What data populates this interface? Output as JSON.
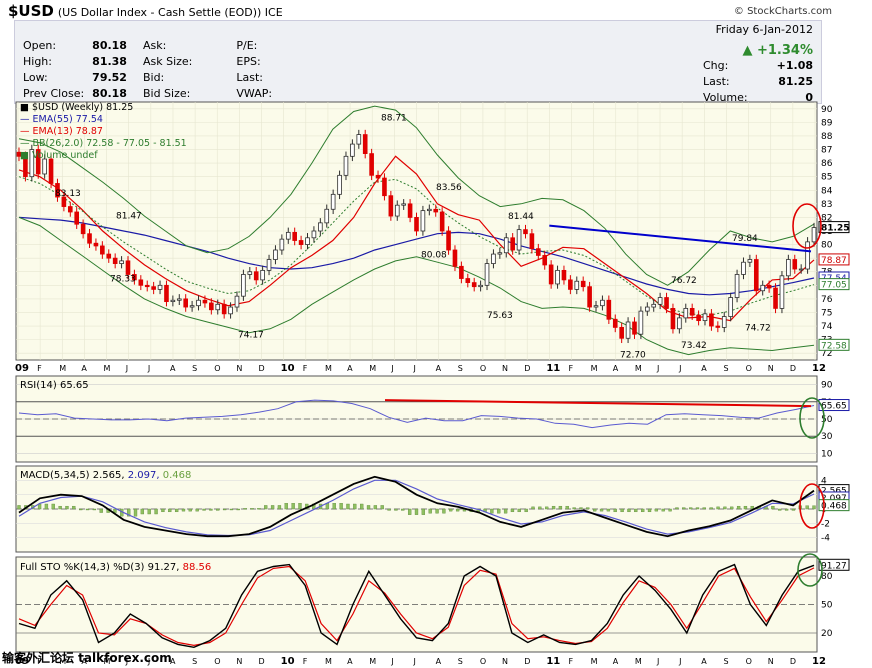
{
  "header": {
    "symbol": "$USD",
    "description": "(US Dollar Index - Cash Settle (EOD)) ICE",
    "brand": "© StockCharts.com"
  },
  "quote": {
    "date": "Friday  6-Jan-2012",
    "change_pct": "▲ +1.34%",
    "rows": [
      {
        "l1": "Open:",
        "v1": "80.18",
        "l2": "Ask:",
        "l3": "P/E:"
      },
      {
        "l1": "High:",
        "v1": "81.38",
        "l2": "Ask Size:",
        "l3": "EPS:"
      },
      {
        "l1": "Low:",
        "v1": "79.52",
        "l2": "Bid:",
        "l3": "Last:"
      },
      {
        "l1": "Prev Close:",
        "v1": "80.18",
        "l2": "Bid Size:",
        "l3": "VWAP:"
      }
    ],
    "chg_label": "Chg:",
    "chg": "+1.08",
    "last_label": "Last:",
    "last": "81.25",
    "volume_label": "Volume:",
    "volume": "0"
  },
  "legend": {
    "main": "■ $USD (Weekly) 81.25",
    "ema55": "— EMA(55) 77.54",
    "ema13": "— EMA(13) 78.87",
    "bb": "— BB(26,2.0) 72.58 - 77.05 - 81.51",
    "vol": "■ Volume undef",
    "rsi": "RSI(14) 65.65",
    "macd_a": "MACD(5,34,5) 2.565,",
    "macd_b": "2.097,",
    "macd_c": "0.468",
    "sto_a": "Full STO %K(14,3) %D(3) 91.27,",
    "sto_b": "88.56"
  },
  "watermark": "输客外汇论坛 talkforex.com",
  "colors": {
    "up": "#2e2e2e",
    "down": "#e00000",
    "ema55": "#1a1aa6",
    "ema13": "#e00000",
    "bb": "#2e7d2e",
    "trend": "#0000cc",
    "bg": "#fbfbea"
  },
  "chart_data": [
    {
      "type": "candlestick",
      "title": "$USD (Weekly) 81.25",
      "x_labels": [
        "09",
        "F",
        "M",
        "A",
        "M",
        "J",
        "J",
        "A",
        "S",
        "O",
        "N",
        "D",
        "10",
        "F",
        "M",
        "A",
        "M",
        "J",
        "J",
        "A",
        "S",
        "O",
        "N",
        "D",
        "11",
        "F",
        "M",
        "A",
        "M",
        "J",
        "J",
        "A",
        "S",
        "O",
        "N",
        "D",
        "12"
      ],
      "ylim": [
        71.5,
        90.5
      ],
      "y_ticks": [
        72,
        73,
        74,
        75,
        76,
        77,
        78,
        79,
        80,
        81,
        82,
        83,
        84,
        85,
        86,
        87,
        88,
        89,
        90
      ],
      "right_labels": [
        "81.25",
        "78.87",
        "77.54",
        "77.05",
        "72.58"
      ],
      "annotations": [
        {
          "x": "2009-02",
          "value": "83.13"
        },
        {
          "x": "2009-05",
          "value": "81.47"
        },
        {
          "x": "2009-06",
          "value": "78.33"
        },
        {
          "x": "2009-11",
          "value": "74.17"
        },
        {
          "x": "2010-06",
          "value": "88.71"
        },
        {
          "x": "2010-08",
          "value": "80.08"
        },
        {
          "x": "2010-09",
          "value": "83.56"
        },
        {
          "x": "2010-11",
          "value": "75.63"
        },
        {
          "x": "2011-01",
          "value": "81.44"
        },
        {
          "x": "2011-05",
          "value": "72.70"
        },
        {
          "x": "2011-08",
          "value": "76.72"
        },
        {
          "x": "2011-08b",
          "value": "73.42"
        },
        {
          "x": "2011-10",
          "value": "79.84"
        },
        {
          "x": "2011-10b",
          "value": "74.72"
        }
      ],
      "close_series": [
        86.5,
        85.0,
        87.0,
        85.2,
        86.3,
        84.5,
        83.5,
        82.8,
        82.4,
        81.5,
        80.8,
        80.1,
        79.9,
        79.3,
        79.0,
        78.6,
        78.8,
        77.8,
        77.4,
        77.0,
        76.9,
        76.7,
        77.0,
        75.8,
        75.9,
        76.0,
        75.4,
        75.5,
        75.9,
        75.7,
        75.2,
        75.6,
        74.9,
        75.4,
        76.2,
        77.8,
        78.0,
        77.4,
        78.1,
        78.9,
        79.6,
        80.4,
        80.9,
        80.3,
        80.0,
        80.5,
        81.0,
        81.6,
        82.6,
        83.7,
        85.1,
        86.5,
        87.4,
        88.1,
        86.7,
        85.1,
        84.9,
        83.6,
        82.1,
        82.9,
        83.0,
        82.0,
        81.0,
        82.5,
        82.6,
        82.4,
        81.0,
        79.6,
        78.4,
        77.5,
        77.2,
        76.9,
        77.0,
        78.6,
        79.3,
        79.4,
        80.5,
        79.6,
        81.1,
        80.8,
        79.7,
        79.2,
        78.5,
        77.1,
        78.1,
        77.4,
        76.7,
        77.3,
        76.9,
        75.4,
        75.5,
        75.9,
        74.5,
        73.9,
        73.1,
        74.3,
        73.4,
        75.1,
        75.4,
        75.6,
        76.1,
        75.3,
        73.8,
        74.6,
        75.3,
        74.8,
        74.4,
        74.9,
        74.0,
        73.9,
        74.7,
        76.1,
        77.8,
        78.7,
        78.9,
        76.6,
        77.0,
        76.8,
        75.3,
        77.7,
        78.9,
        78.2,
        78.2,
        80.2,
        81.25
      ],
      "series": [
        {
          "name": "EMA(55)",
          "values": [
            82.0,
            81.9,
            81.8,
            81.6,
            81.3,
            81.0,
            80.7,
            80.3,
            79.9,
            79.5,
            79.0,
            78.6,
            78.3,
            78.2,
            78.3,
            78.6,
            79.0,
            79.6,
            80.0,
            80.4,
            80.8,
            80.9,
            80.8,
            80.4,
            79.9,
            79.5,
            79.1,
            78.6,
            78.1,
            77.6,
            77.1,
            76.7,
            76.4,
            76.3,
            76.4,
            76.6,
            76.9,
            77.2,
            77.54
          ]
        },
        {
          "name": "EMA(13)",
          "values": [
            85.5,
            85.0,
            84.0,
            82.6,
            81.0,
            79.7,
            78.5,
            77.5,
            76.6,
            76.0,
            75.5,
            75.8,
            77.0,
            78.3,
            79.2,
            80.3,
            82.0,
            84.5,
            86.5,
            85.2,
            83.0,
            82.2,
            81.8,
            80.0,
            78.4,
            79.0,
            79.8,
            79.7,
            78.6,
            77.5,
            76.4,
            75.1,
            74.6,
            74.7,
            74.4,
            76.0,
            77.4,
            77.5,
            78.87
          ]
        },
        {
          "name": "BB upper",
          "values": [
            87.8,
            87.5,
            86.8,
            85.7,
            84.6,
            83.4,
            82.1,
            81.0,
            79.9,
            79.4,
            79.7,
            80.6,
            82.0,
            83.7,
            86.0,
            88.5,
            89.8,
            90.2,
            89.9,
            88.6,
            86.6,
            84.9,
            83.6,
            82.8,
            83.0,
            83.4,
            83.3,
            82.5,
            81.2,
            79.3,
            77.8,
            77.0,
            78.0,
            79.6,
            81.0,
            80.5,
            80.2,
            80.6,
            81.51
          ]
        },
        {
          "name": "BB middle",
          "values": [
            85.0,
            84.5,
            83.6,
            82.5,
            81.3,
            80.2,
            79.2,
            78.2,
            77.3,
            76.8,
            76.4,
            76.6,
            77.4,
            78.5,
            80.0,
            81.6,
            83.2,
            84.6,
            84.8,
            84.1,
            82.7,
            81.6,
            80.6,
            79.8,
            79.3,
            79.5,
            79.6,
            79.2,
            78.4,
            77.3,
            76.2,
            75.3,
            74.9,
            74.8,
            75.1,
            75.7,
            76.2,
            76.6,
            77.05
          ]
        },
        {
          "name": "BB lower",
          "values": [
            82.0,
            81.4,
            80.3,
            79.2,
            78.1,
            77.0,
            76.0,
            75.3,
            74.7,
            74.3,
            73.9,
            73.5,
            73.8,
            74.5,
            75.6,
            76.5,
            77.4,
            78.2,
            78.8,
            79.1,
            78.7,
            78.3,
            77.6,
            76.8,
            75.8,
            75.3,
            75.4,
            75.3,
            74.8,
            74.1,
            73.0,
            72.3,
            71.9,
            72.2,
            72.4,
            72.3,
            72.2,
            72.4,
            72.58
          ]
        }
      ],
      "trendline": [
        {
          "x": "2011-01",
          "y": 81.4
        },
        {
          "x": "2012-01",
          "y": 79.5
        }
      ]
    },
    {
      "type": "line",
      "title": "RSI(14) 65.65",
      "ylim": [
        0,
        100
      ],
      "y_ticks": [
        10,
        30,
        50,
        70,
        90
      ],
      "right_labels": [
        "65.65"
      ],
      "values": [
        57,
        55,
        56,
        51,
        50,
        49,
        49,
        50,
        48,
        51,
        52,
        53,
        55,
        58,
        62,
        70,
        72,
        71,
        68,
        62,
        52,
        46,
        51,
        48,
        48,
        54,
        53,
        51,
        50,
        45,
        44,
        40,
        43,
        45,
        44,
        55,
        56,
        55,
        54,
        52,
        51,
        57,
        61,
        65.65
      ]
    },
    {
      "type": "line",
      "title": "MACD(5,34,5) 2.565, 2.097, 0.468",
      "ylim": [
        -6,
        6
      ],
      "y_ticks": [
        4,
        2,
        0,
        -2,
        -4
      ],
      "right_labels": [
        "2.565",
        "2.097",
        "0.468"
      ],
      "series": [
        {
          "name": "MACD",
          "values": [
            -0.5,
            1.5,
            2.0,
            1.8,
            0.5,
            -1.5,
            -2.5,
            -3.0,
            -3.5,
            -3.8,
            -3.8,
            -3.5,
            -2.5,
            -0.8,
            0.5,
            2.0,
            3.5,
            4.5,
            3.8,
            2.0,
            0.8,
            0.3,
            -0.5,
            -1.8,
            -2.5,
            -1.5,
            -0.5,
            -0.2,
            -1.2,
            -2.2,
            -3.2,
            -3.8,
            -3.0,
            -2.4,
            -1.6,
            -0.2,
            1.2,
            0.5,
            2.565
          ]
        },
        {
          "name": "Signal",
          "values": [
            -1.0,
            0.8,
            1.6,
            1.8,
            1.0,
            -0.5,
            -1.8,
            -2.6,
            -3.2,
            -3.6,
            -3.7,
            -3.6,
            -3.0,
            -1.6,
            -0.2,
            1.2,
            2.8,
            4.0,
            4.0,
            2.8,
            1.4,
            0.6,
            -0.1,
            -1.2,
            -2.1,
            -1.8,
            -0.9,
            -0.4,
            -0.9,
            -1.8,
            -2.8,
            -3.5,
            -3.2,
            -2.6,
            -1.9,
            -0.6,
            0.8,
            0.7,
            2.097
          ]
        },
        {
          "name": "Histogram",
          "values": [
            0.5,
            0.7,
            0.4,
            0.0,
            -0.5,
            -1.0,
            -0.7,
            -0.4,
            -0.3,
            -0.2,
            -0.1,
            0.1,
            0.5,
            0.8,
            0.7,
            0.8,
            0.7,
            0.5,
            -0.2,
            -0.8,
            -0.6,
            -0.3,
            -0.4,
            -0.6,
            -0.4,
            0.3,
            0.4,
            0.2,
            -0.3,
            -0.4,
            -0.4,
            -0.3,
            0.2,
            0.2,
            0.3,
            0.4,
            0.4,
            -0.2,
            0.468
          ]
        }
      ]
    },
    {
      "type": "line",
      "title": "Full STO %K(14,3) %D(3) 91.27, 88.56",
      "ylim": [
        0,
        100
      ],
      "y_ticks": [
        20,
        50,
        80
      ],
      "right_labels": [
        "91.27"
      ],
      "series": [
        {
          "name": "%K",
          "values": [
            30,
            25,
            60,
            75,
            55,
            10,
            20,
            40,
            30,
            15,
            8,
            5,
            12,
            25,
            60,
            85,
            90,
            92,
            70,
            20,
            8,
            50,
            85,
            60,
            35,
            15,
            12,
            30,
            80,
            90,
            80,
            20,
            10,
            18,
            10,
            8,
            12,
            30,
            60,
            80,
            65,
            45,
            20,
            60,
            85,
            92,
            50,
            28,
            60,
            85,
            91.27
          ]
        },
        {
          "name": "%D",
          "values": [
            35,
            28,
            50,
            70,
            60,
            20,
            18,
            35,
            30,
            18,
            10,
            7,
            10,
            20,
            50,
            78,
            88,
            90,
            75,
            30,
            12,
            40,
            75,
            62,
            40,
            20,
            14,
            26,
            70,
            86,
            82,
            30,
            14,
            16,
            12,
            9,
            11,
            25,
            52,
            75,
            68,
            50,
            25,
            52,
            80,
            88,
            58,
            32,
            55,
            80,
            88.56
          ]
        }
      ]
    }
  ]
}
